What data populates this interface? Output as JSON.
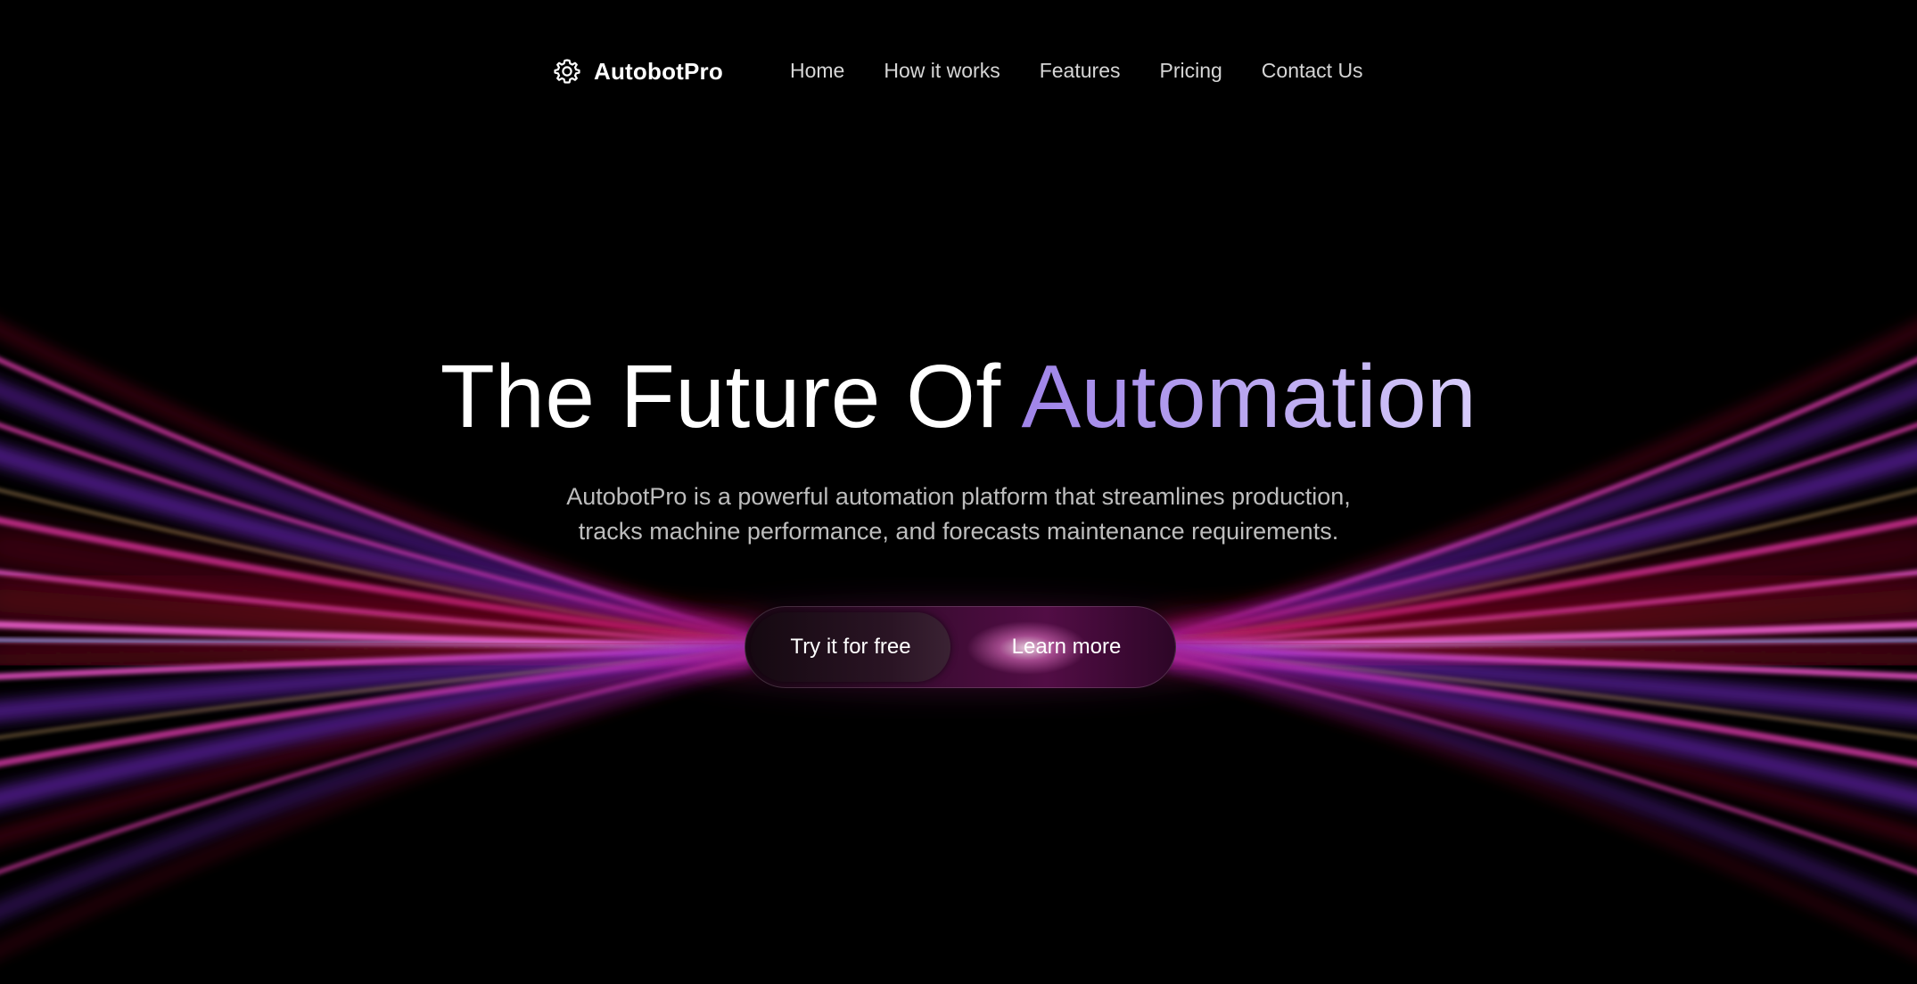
{
  "nav": {
    "brand_name": "AutobotPro",
    "brand_icon": "gear-icon",
    "links": [
      "Home",
      "How it works",
      "Features",
      "Pricing",
      "Contact Us"
    ]
  },
  "hero": {
    "title_main": "The Future Of ",
    "title_accent": "Automation",
    "subtitle_line1": "AutobotPro is a powerful automation platform that streamlines production,",
    "subtitle_line2": "tracks machine performance, and forecasts maintenance requirements."
  },
  "cta": {
    "primary_label": "Try it for free",
    "secondary_label": "Learn more"
  },
  "colors": {
    "background": "#000000",
    "accent_start": "#9f84e8",
    "accent_end": "#d7ccfa",
    "ray_magenta": "#d93aa8",
    "ray_purple": "#7a2bd6",
    "ray_red": "#a0102a"
  }
}
